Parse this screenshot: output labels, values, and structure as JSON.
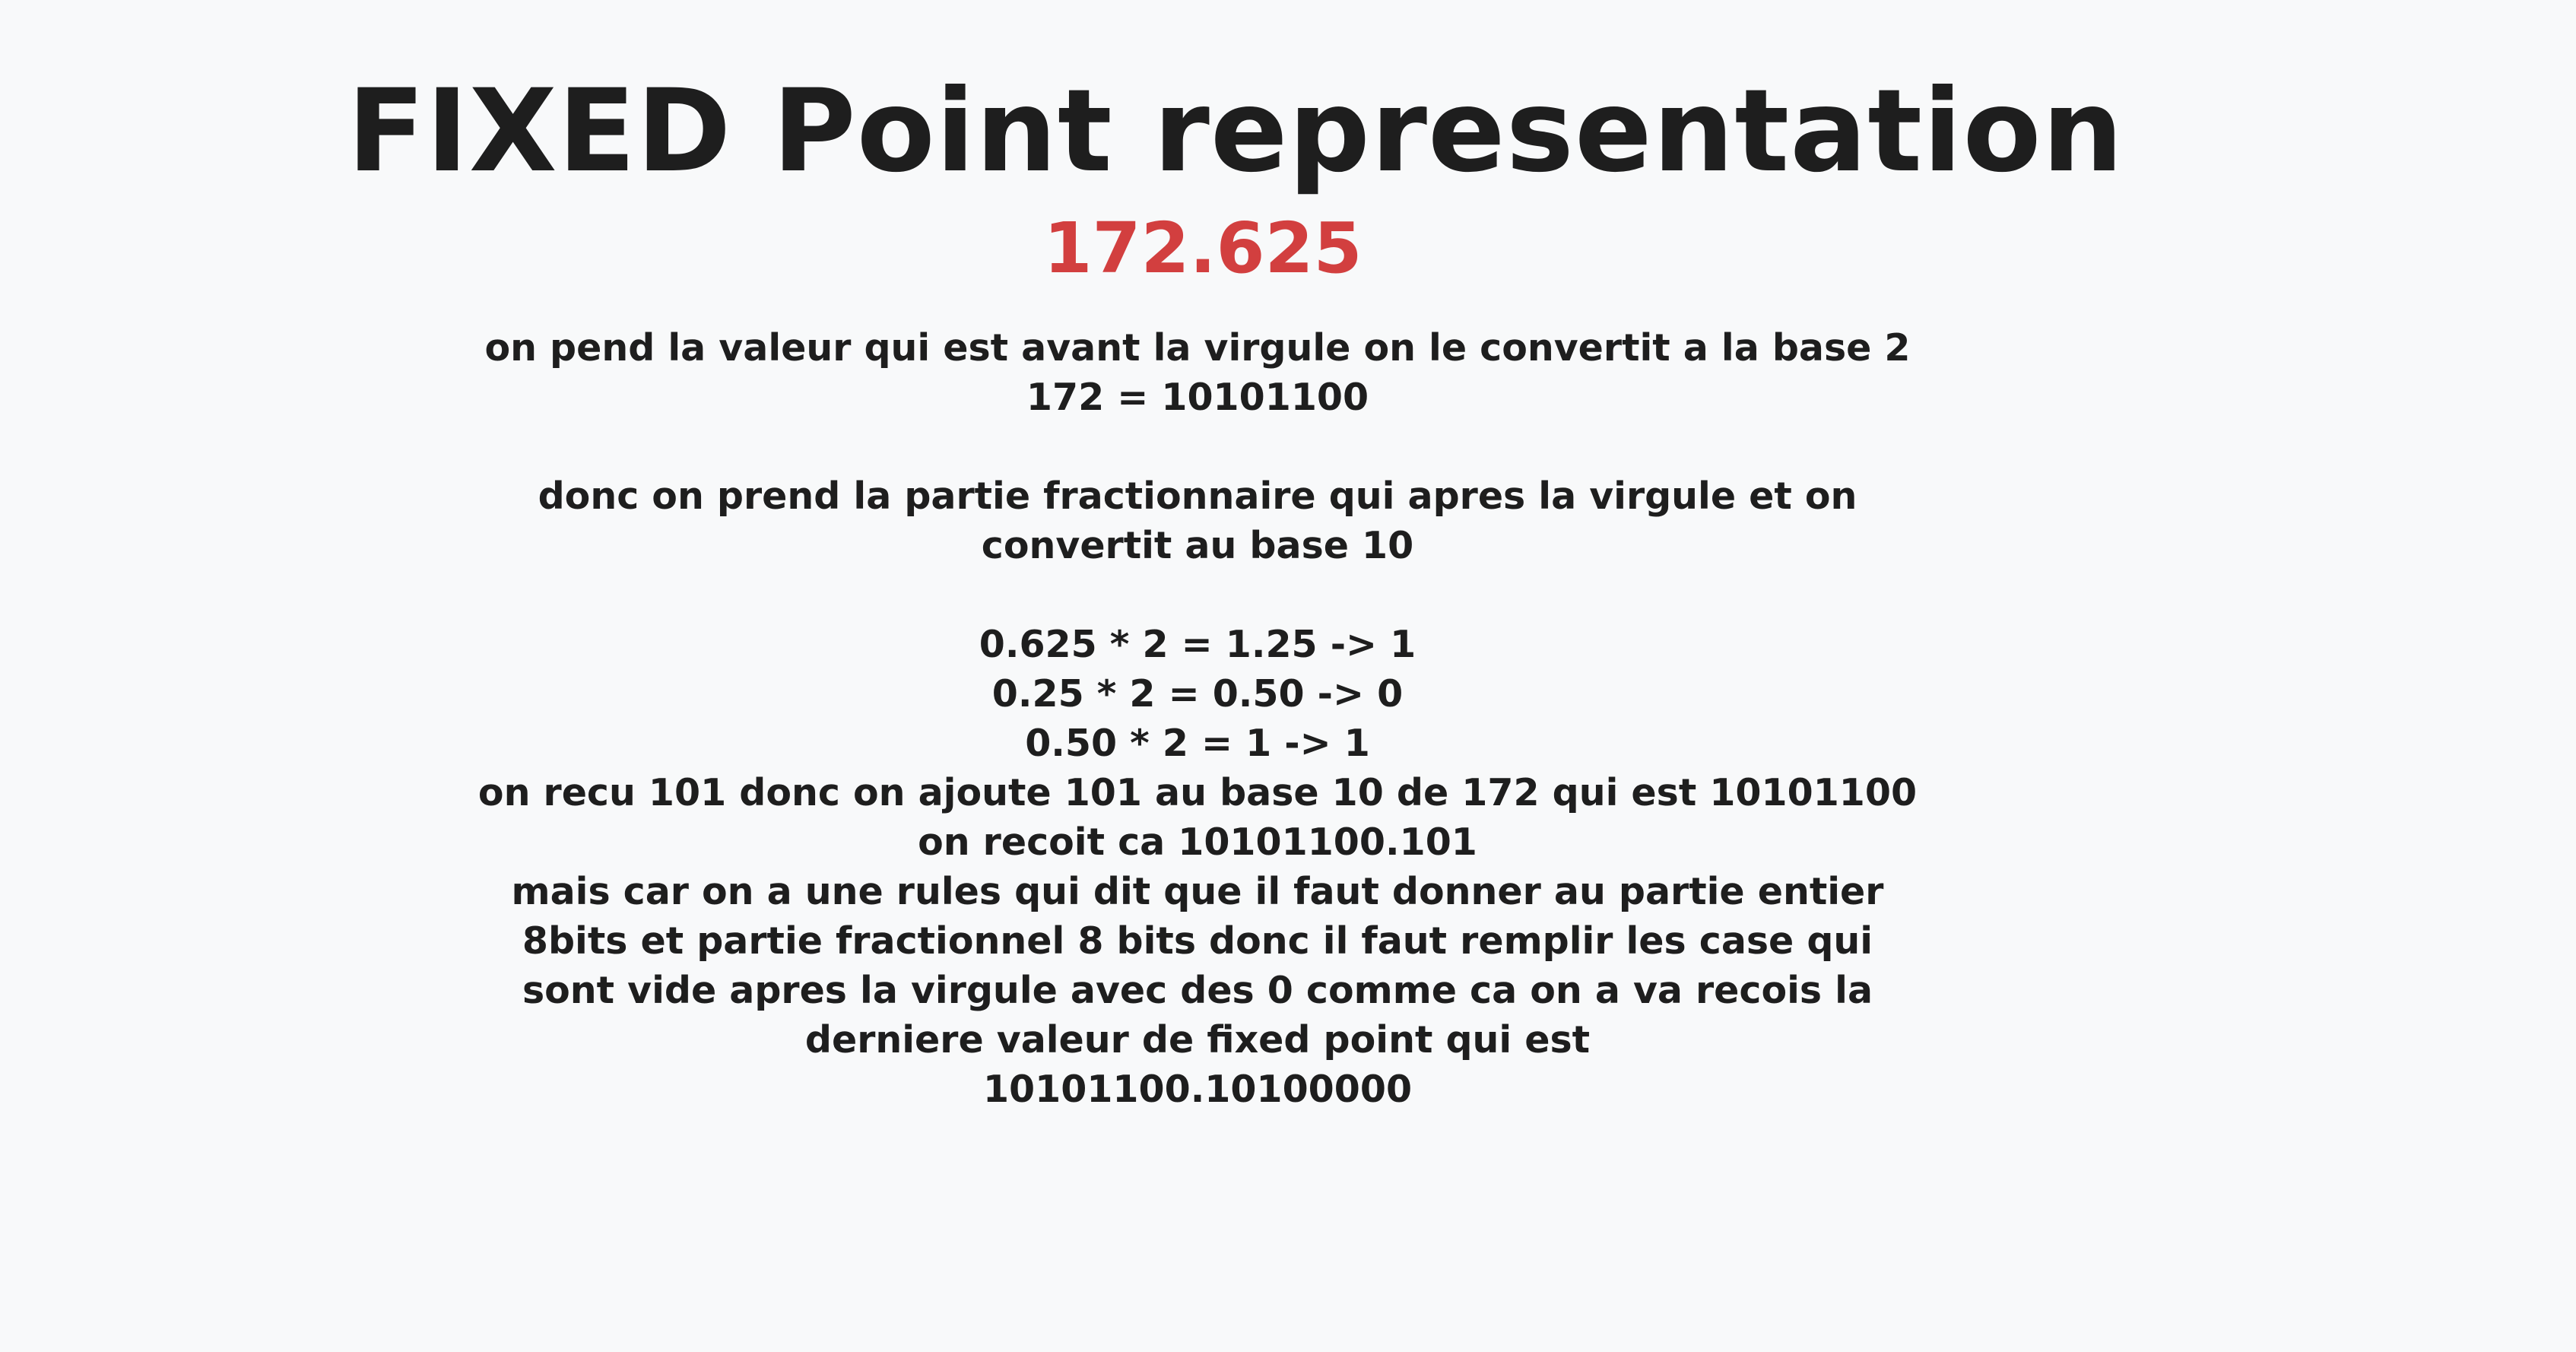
{
  "title": "FIXED Point representation",
  "number": "172.625",
  "lines": [
    "on pend la valeur qui est avant la virgule on le convertit a la base 2",
    "172 = 10101100",
    "",
    "donc on prend la partie fractionnaire qui apres la virgule et on",
    "convertit au base 10",
    "",
    "0.625 * 2 = 1.25 -> 1",
    "0.25 * 2 = 0.50 -> 0",
    "0.50 * 2 = 1 -> 1",
    "on recu 101 donc on ajoute 101 au base 10 de 172 qui est 10101100",
    "on recoit ca 10101100.101",
    "mais car on a une rules qui dit que il faut donner au partie entier",
    "8bits et partie fractionnel 8 bits donc il faut remplir les case qui",
    "sont vide apres la virgule avec des 0 comme ca on a va recois la",
    "derniere valeur de fixed point qui est",
    "10101100.10100000"
  ],
  "colors": {
    "background": "#f8f9fa",
    "text": "#1e1e1e",
    "accent": "#d23f3f"
  }
}
